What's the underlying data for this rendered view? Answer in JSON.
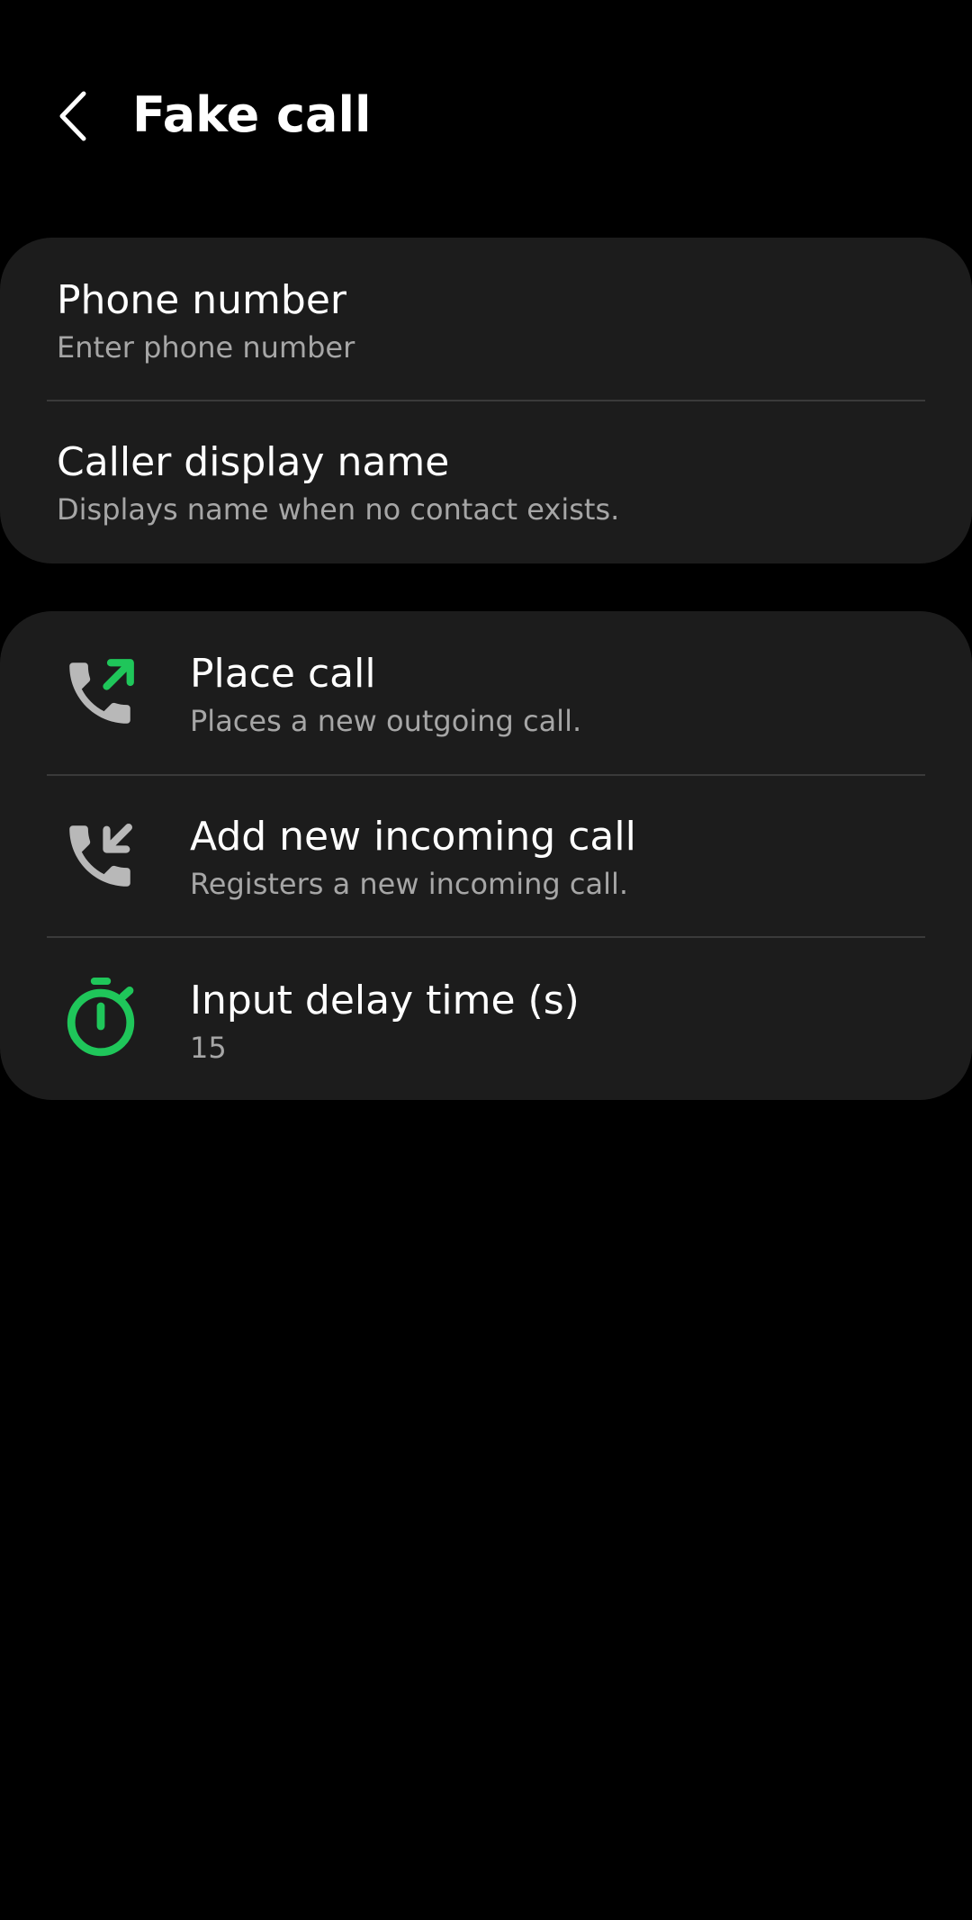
{
  "header": {
    "title": "Fake call",
    "back_icon": "chevron-left-icon"
  },
  "identity_section": {
    "items": [
      {
        "title": "Phone number",
        "subtitle": "Enter phone number"
      },
      {
        "title": "Caller display name",
        "subtitle": "Displays name when no contact exists."
      }
    ]
  },
  "actions_section": {
    "items": [
      {
        "title": "Place call",
        "subtitle": "Places a new outgoing call.",
        "icon": "outgoing-call-icon"
      },
      {
        "title": "Add new incoming call",
        "subtitle": "Registers a new incoming call.",
        "icon": "incoming-call-icon"
      },
      {
        "title": "Input delay time (s)",
        "subtitle": "15",
        "icon": "timer-icon"
      }
    ]
  },
  "colors": {
    "background": "#000000",
    "card": "#1c1c1c",
    "divider": "#3a3a3a",
    "subtitle": "#a6a6a6",
    "accent_green": "#1fc65a",
    "icon_gray": "#b8b8b8"
  }
}
